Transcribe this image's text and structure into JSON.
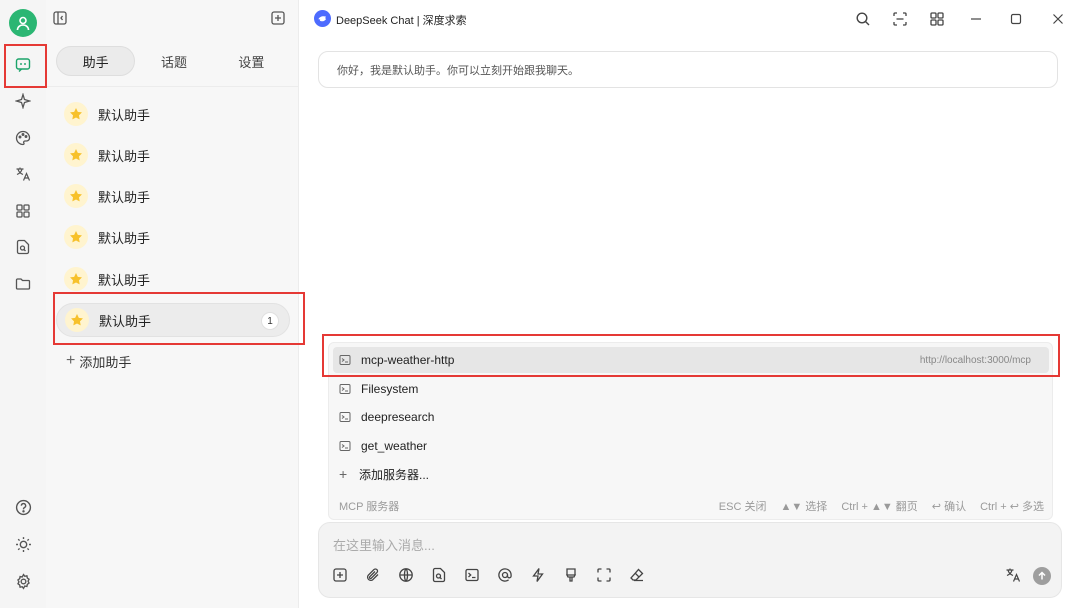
{
  "window": {
    "title": "DeepSeek Chat | 深度求索"
  },
  "rail": {
    "icons": [
      "chat-icon",
      "sparkle-icon",
      "palette-icon",
      "translate-icon",
      "apps-icon",
      "file-search-icon",
      "folder-icon",
      "help-icon",
      "sun-icon",
      "settings-icon"
    ]
  },
  "panel": {
    "tabs": [
      "助手",
      "话题",
      "设置"
    ],
    "active_tab": "助手",
    "assistants": [
      {
        "name": "默认助手"
      },
      {
        "name": "默认助手"
      },
      {
        "name": "默认助手"
      },
      {
        "name": "默认助手"
      },
      {
        "name": "默认助手"
      },
      {
        "name": "默认助手",
        "badge": "1",
        "selected": true
      }
    ],
    "add_assistant_label": "添加助手"
  },
  "chat": {
    "greeting": "你好，我是默认助手。你可以立刻开始跟我聊天。"
  },
  "mcp": {
    "servers": [
      {
        "name": "mcp-weather-http",
        "url": "http://localhost:3000/mcp",
        "highlighted": true
      },
      {
        "name": "Filesystem"
      },
      {
        "name": "deepresearch"
      },
      {
        "name": "get_weather"
      }
    ],
    "add_server_label": "添加服务器...",
    "footer_title": "MCP 服务器",
    "hints": [
      "ESC 关闭",
      "▲▼ 选择",
      "Ctrl + ▲▼ 翻页",
      "↩ 确认",
      "Ctrl + ↩ 多选"
    ]
  },
  "input": {
    "placeholder": "在这里输入消息..."
  },
  "colors": {
    "accent_green": "#2bb673",
    "highlight_red": "#e53935",
    "deepseek_blue": "#4d6bfe"
  }
}
